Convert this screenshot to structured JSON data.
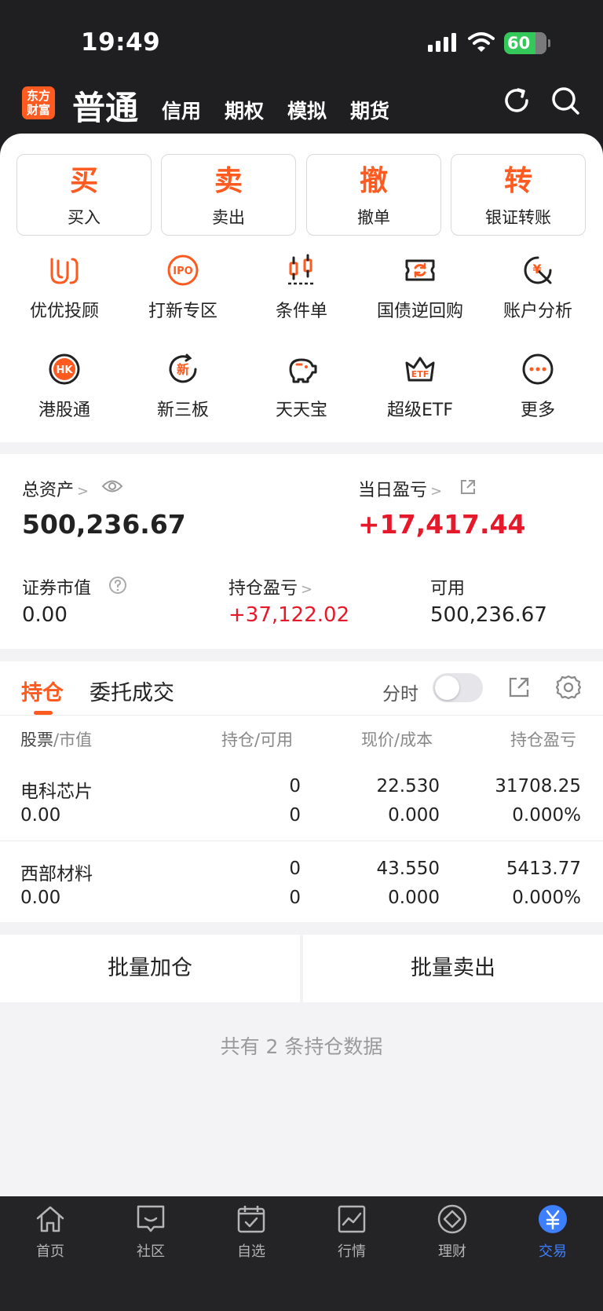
{
  "status_bar": {
    "time": "19:49",
    "battery": "60"
  },
  "header": {
    "logo_text": "东方财富",
    "active_tab": "普通",
    "tabs": [
      "信用",
      "期权",
      "模拟",
      "期货"
    ]
  },
  "quick_actions": [
    {
      "glyph": "买",
      "label": "买入"
    },
    {
      "glyph": "卖",
      "label": "卖出"
    },
    {
      "glyph": "撤",
      "label": "撤单"
    },
    {
      "glyph": "转",
      "label": "银证转账"
    }
  ],
  "grid": [
    {
      "label": "优优投顾",
      "icon": "youyou-icon"
    },
    {
      "label": "打新专区",
      "icon": "ipo-icon",
      "icon_text": "IPO"
    },
    {
      "label": "条件单",
      "icon": "candlestick-icon"
    },
    {
      "label": "国债逆回购",
      "icon": "repo-icon"
    },
    {
      "label": "账户分析",
      "icon": "yuan-chart-icon",
      "icon_text": "¥"
    },
    {
      "label": "港股通",
      "icon": "hk-icon",
      "icon_text": "HK"
    },
    {
      "label": "新三板",
      "icon": "new-board-icon",
      "icon_text": "新"
    },
    {
      "label": "天天宝",
      "icon": "piggy-bank-icon"
    },
    {
      "label": "超级ETF",
      "icon": "etf-crown-icon",
      "icon_text": "ETF"
    },
    {
      "label": "更多",
      "icon": "more-icon"
    }
  ],
  "assets": {
    "total_label": "总资产",
    "total_value": "500,236.67",
    "daily_pnl_label": "当日盈亏",
    "daily_pnl_value": "+17,417.44",
    "market_value_label": "证券市值",
    "market_value": "0.00",
    "position_pnl_label": "持仓盈亏",
    "position_pnl": "+37,122.02",
    "available_label": "可用",
    "available": "500,236.67"
  },
  "positions": {
    "tab_active": "持仓",
    "tab_other": "委托成交",
    "timeshare_label": "分时",
    "headers": {
      "col1a": "股票",
      "col1b": "市值",
      "col2a": "持仓",
      "col2b": "可用",
      "col3a": "现价",
      "col3b": "成本",
      "col4": "持仓盈亏"
    },
    "rows": [
      {
        "name": "电科芯片",
        "market_value": "0.00",
        "hold": "0",
        "avail": "0",
        "price": "22.530",
        "cost": "0.000",
        "pnl": "31708.25",
        "pnl_pct": "0.000%"
      },
      {
        "name": "西部材料",
        "market_value": "0.00",
        "hold": "0",
        "avail": "0",
        "price": "43.550",
        "cost": "0.000",
        "pnl": "5413.77",
        "pnl_pct": "0.000%"
      }
    ],
    "batch_add": "批量加仓",
    "batch_sell": "批量卖出",
    "summary": "共有 2 条持仓数据"
  },
  "nav": [
    {
      "label": "首页",
      "icon": "home-icon"
    },
    {
      "label": "社区",
      "icon": "community-icon"
    },
    {
      "label": "自选",
      "icon": "watchlist-icon"
    },
    {
      "label": "行情",
      "icon": "market-icon"
    },
    {
      "label": "理财",
      "icon": "wealth-icon"
    },
    {
      "label": "交易",
      "icon": "trade-icon",
      "active": true
    }
  ],
  "colors": {
    "accent": "#ff5a1f",
    "profit_red": "#e6192b",
    "nav_active": "#3d7fff",
    "header_bg": "#1f1f21"
  }
}
